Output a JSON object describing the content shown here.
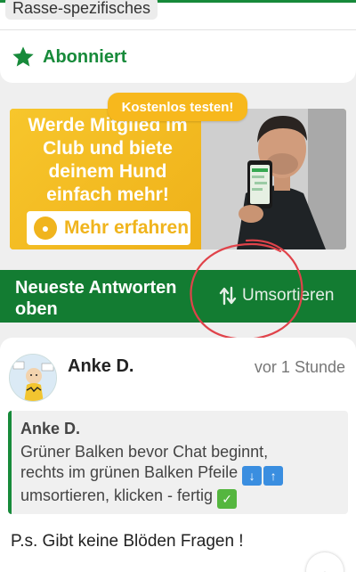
{
  "top": {
    "tag_label": "Rasse-spezifisches",
    "subscription_label": "Abonniert"
  },
  "promo": {
    "badge_label": "Kostenlos testen!",
    "headline": "Werde Mitglied im Club und biete deinem Hund einfach mehr!",
    "button_label": "Mehr erfahren"
  },
  "sort_bar": {
    "title": "Neueste Antworten oben",
    "sort_button_label": "Umsortieren"
  },
  "answer": {
    "author": "Anke D.",
    "time": "vor 1 Stunde",
    "quote": {
      "author": "Anke D.",
      "line1": "Grüner Balken bevor Chat beginnt,",
      "line2": "rechts im grünen Balken Pfeile",
      "line3": "umsortieren, klicken - fertig"
    },
    "text": "P.s. Gibt keine Blöden Fragen !"
  },
  "colors": {
    "brand_green": "#137c32",
    "accent_yellow": "#f7b81d",
    "annotation_red": "#e0434a"
  }
}
